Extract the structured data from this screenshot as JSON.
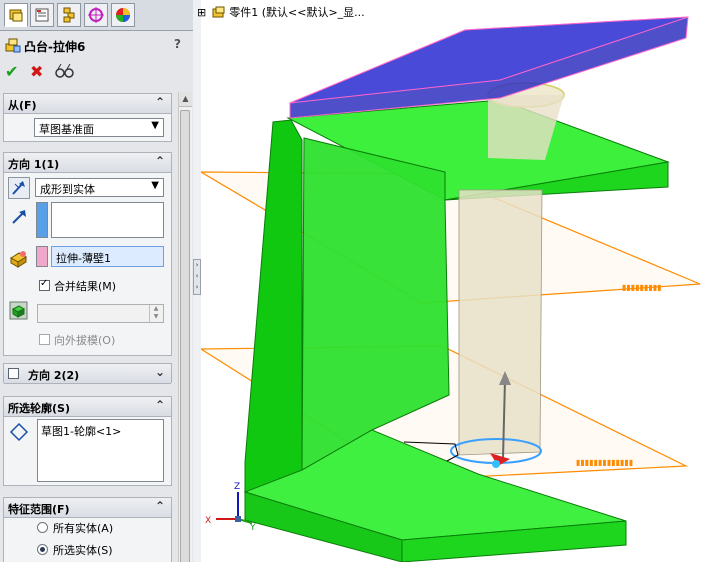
{
  "panel": {
    "tabs": [
      {
        "icon": "feature-manager-icon",
        "active": true
      },
      {
        "icon": "property-manager-icon"
      },
      {
        "icon": "configuration-manager-icon"
      },
      {
        "icon": "dimxpert-icon"
      },
      {
        "icon": "display-manager-icon"
      }
    ],
    "title": "凸台-拉伸6",
    "help": "?",
    "actions": {
      "ok": "✔",
      "cancel": "✖",
      "preview": "66"
    }
  },
  "from": {
    "header": "从(F)",
    "collapse": "⌃",
    "start_condition": "草图基准面"
  },
  "direction1": {
    "header": "方向 1(1)",
    "collapse": "⌃",
    "end_condition": "成形到实体",
    "selection_color": "#5aa0e8",
    "body_color": "#f0a8c8",
    "body_value": "拉伸-薄壁1",
    "merge_label": "合并结果(M)",
    "merge_checked": true,
    "draft_label": "向外拔模(O)",
    "draft_checked": false
  },
  "direction2": {
    "header": "方向 2(2)",
    "collapse": "⌄"
  },
  "contours": {
    "header": "所选轮廓(S)",
    "collapse": "⌃",
    "items": [
      "草图1-轮廓<1>"
    ]
  },
  "scope": {
    "header": "特征范围(F)",
    "collapse": "⌃",
    "options": [
      {
        "label": "所有实体(A)",
        "selected": false
      },
      {
        "label": "所选实体(S)",
        "selected": true
      }
    ]
  },
  "tree": {
    "expander": "⊞",
    "label": "零件1  (默认<<默认>_显..."
  },
  "triad": {
    "x": "X",
    "y": "Y",
    "z": "Z"
  },
  "colors": {
    "solid_green": "#22e61a",
    "top_plate": "#3c3cc8",
    "plane_orange": "#ff8c00"
  }
}
